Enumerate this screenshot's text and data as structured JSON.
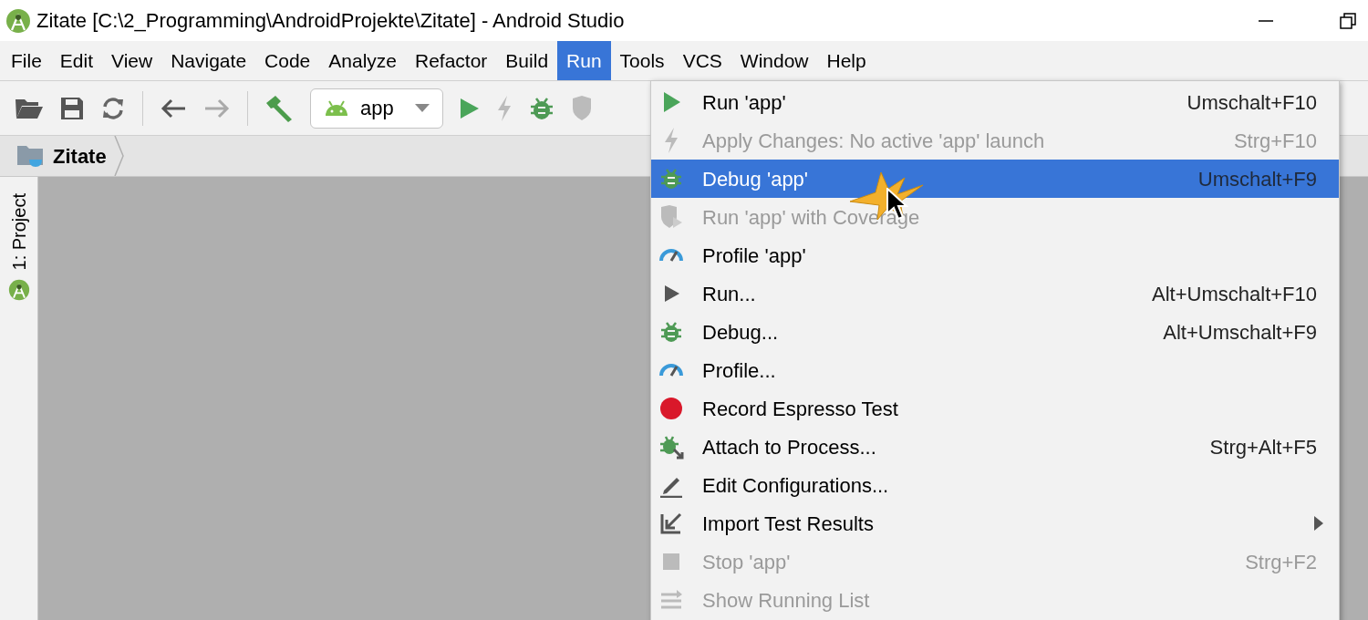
{
  "window": {
    "title": "Zitate [C:\\2_Programming\\AndroidProjekte\\Zitate] - Android Studio"
  },
  "menubar": [
    {
      "label": "File",
      "selected": false
    },
    {
      "label": "Edit",
      "selected": false
    },
    {
      "label": "View",
      "selected": false
    },
    {
      "label": "Navigate",
      "selected": false
    },
    {
      "label": "Code",
      "selected": false
    },
    {
      "label": "Analyze",
      "selected": false
    },
    {
      "label": "Refactor",
      "selected": false
    },
    {
      "label": "Build",
      "selected": false
    },
    {
      "label": "Run",
      "selected": true
    },
    {
      "label": "Tools",
      "selected": false
    },
    {
      "label": "VCS",
      "selected": false
    },
    {
      "label": "Window",
      "selected": false
    },
    {
      "label": "Help",
      "selected": false
    }
  ],
  "toolbar": {
    "config": "app"
  },
  "breadcrumb": [
    "Zitate"
  ],
  "side_tab": {
    "label": "1: Project"
  },
  "run_menu": [
    {
      "kind": "run",
      "label": "Run 'app'",
      "shortcut": "Umschalt+F10",
      "disabled": false,
      "selected": false
    },
    {
      "kind": "apply",
      "label": "Apply Changes: No active 'app' launch",
      "shortcut": "Strg+F10",
      "disabled": true,
      "selected": false
    },
    {
      "kind": "debug",
      "label": "Debug 'app'",
      "shortcut": "Umschalt+F9",
      "disabled": false,
      "selected": true
    },
    {
      "kind": "coverage",
      "label": "Run 'app' with Coverage",
      "disabled": true,
      "selected": false
    },
    {
      "kind": "profile",
      "label": "Profile 'app'",
      "disabled": false,
      "selected": false
    },
    {
      "kind": "runconfig",
      "label": "Run...",
      "shortcut": "Alt+Umschalt+F10",
      "disabled": false,
      "selected": false
    },
    {
      "kind": "debug",
      "label": "Debug...",
      "shortcut": "Alt+Umschalt+F9",
      "disabled": false,
      "selected": false
    },
    {
      "kind": "profile",
      "label": "Profile...",
      "disabled": false,
      "selected": false
    },
    {
      "kind": "record",
      "label": "Record Espresso Test",
      "disabled": false,
      "selected": false
    },
    {
      "kind": "attach",
      "label": "Attach to Process...",
      "shortcut": "Strg+Alt+F5",
      "disabled": false,
      "selected": false
    },
    {
      "kind": "edit",
      "label": "Edit Configurations...",
      "disabled": false,
      "selected": false
    },
    {
      "kind": "import",
      "label": "Import Test Results",
      "disabled": false,
      "selected": false,
      "submenu": true
    },
    {
      "kind": "stop",
      "label": "Stop 'app'",
      "shortcut": "Strg+F2",
      "disabled": true,
      "selected": false
    },
    {
      "kind": "list",
      "label": "Show Running List",
      "disabled": true,
      "selected": false
    }
  ]
}
